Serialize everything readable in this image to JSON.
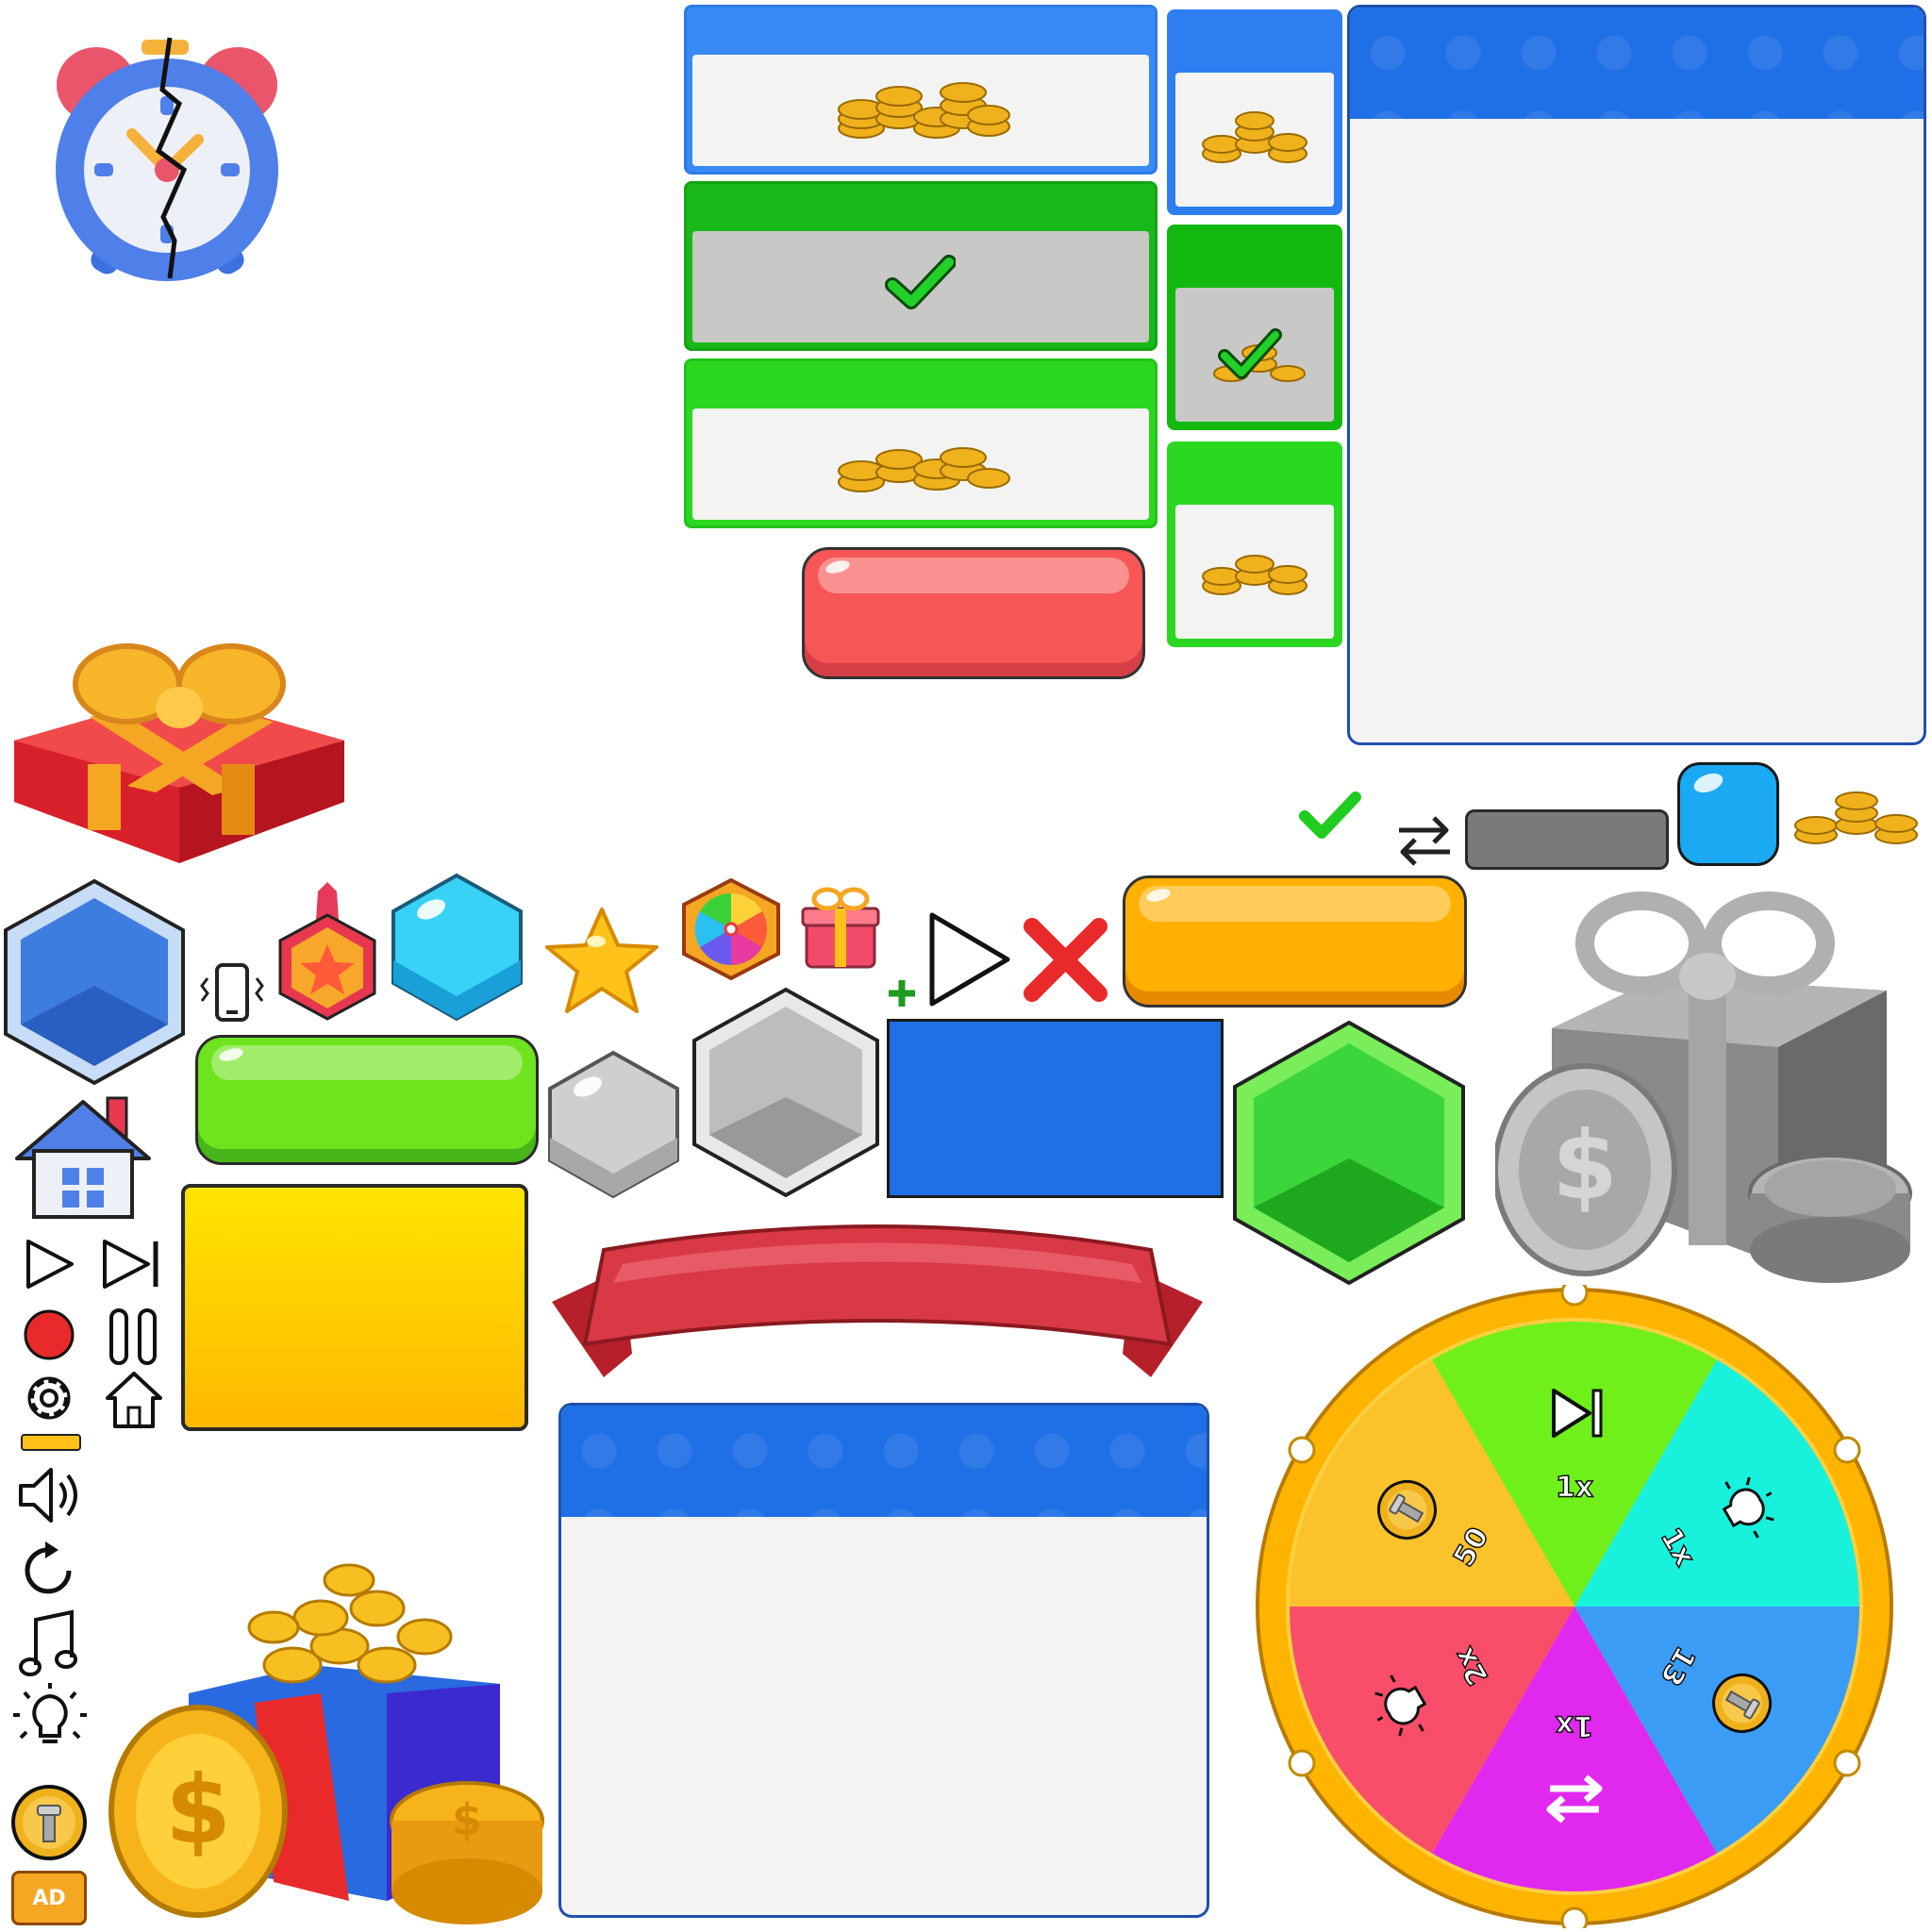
{
  "colors": {
    "blue": "#1f6fe6",
    "green": "#18c418",
    "bright_green": "#2bd821",
    "red": "#f54f55",
    "orange": "#ffb000",
    "gray": "#7a7a7a",
    "cyan": "#1aa9f2",
    "yellow": "#ffd400"
  },
  "icons": {
    "alarm_clock": "broken-alarm-clock-icon",
    "gift": "gift-box-icon",
    "coins": "coin-stack-icon",
    "check": "checkmark-icon",
    "swap": "swap-arrows-icon",
    "play": "play-icon",
    "skip": "skip-forward-icon",
    "record": "record-dot-icon",
    "pause": "pause-icon",
    "settings": "gear-icon",
    "home": "home-icon",
    "sound": "speaker-icon",
    "restart": "restart-icon",
    "music": "music-note-icon",
    "hint": "lightbulb-icon",
    "screw_coin": "screw-coin-icon",
    "vibration": "phone-vibrate-icon",
    "star": "star-icon",
    "close": "close-x-icon",
    "plus": "plus-icon",
    "wheel": "spin-wheel-icon",
    "ribbon": "ribbon-banner"
  },
  "labels": {
    "ad": "AD"
  },
  "wheel": {
    "segments": [
      {
        "label": "1x",
        "icon": "skip-forward-icon",
        "color": "#6ff01a"
      },
      {
        "label": "1x",
        "icon": "lightbulb-icon",
        "color": "#18f1dc"
      },
      {
        "label": "13",
        "icon": "screw-coin-icon",
        "color": "#3a9cf5"
      },
      {
        "label": "1x",
        "icon": "swap-arrows-icon",
        "color": "#e128ef"
      },
      {
        "label": "2x",
        "icon": "lightbulb-icon",
        "color": "#f94e69"
      },
      {
        "label": "50",
        "icon": "screw-coin-icon",
        "color": "#fbc22c"
      }
    ]
  }
}
